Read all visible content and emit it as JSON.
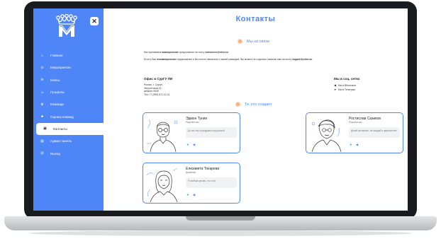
{
  "sidebar": {
    "close_label": "✕",
    "items": [
      {
        "label": "Главная",
        "icon": "home-icon",
        "glyph": "⌂",
        "active": false
      },
      {
        "label": "Мероприятия",
        "icon": "location-icon",
        "glyph": "⊙",
        "active": false
      },
      {
        "label": "Кейсы",
        "icon": "case-icon",
        "glyph": "⊖",
        "active": false
      },
      {
        "label": "Профиль",
        "icon": "profile-icon",
        "glyph": "☺",
        "active": false
      },
      {
        "label": "Команда",
        "icon": "team-icon",
        "glyph": "⊕",
        "active": false
      },
      {
        "label": "Оценка команд",
        "icon": "rating-icon",
        "glyph": "♣",
        "active": false
      },
      {
        "label": "Контакты",
        "icon": "contacts-icon",
        "glyph": "▣",
        "active": true
      },
      {
        "label": "Админ панель",
        "icon": "admin-icon",
        "glyph": "▤",
        "active": false
      },
      {
        "label": "Выход",
        "icon": "logout-icon",
        "glyph": "⊟",
        "active": false
      }
    ]
  },
  "main": {
    "title": "Контакты",
    "in_touch": {
      "title": "Мы на связи",
      "line1_pre": "Мы принимаем ",
      "line1_bold": "коммерческие",
      "line1_mid": " предложения на почту ",
      "line1_email": "commerce@edro.su",
      "line2_pre": "Если у Вас ",
      "line2_bold": "некоммерческое",
      "line2_mid": " предложение и Вы хотите связаться с нашей командой, Вы можете это сделать написав нам на почту ",
      "line2_email": "support@edro.su"
    },
    "office": {
      "title": "Офис в СурГУ ПИ",
      "lines": [
        "Россия, г. Сургут,",
        "Энергетиков 22,",
        "кабинет 900Е",
        "Тел: +7 (999) 571 10-31"
      ]
    },
    "social": {
      "title": "Мы в соц. сетях",
      "items": [
        {
          "label": "Мы в ВКонтакте",
          "icon": "vk-icon",
          "glyph": "◀"
        },
        {
          "label": "Мы в Телеграм",
          "icon": "telegram-icon",
          "glyph": "➤"
        }
      ]
    },
    "creators": {
      "title": "Те, кто создает",
      "cards": [
        {
          "name": "Эдмон Тунян",
          "role": "Разработчик",
          "quote": "До сих пор в раздумья над фразой"
        },
        {
          "name": "Ростислав Сазиков",
          "role": "Разработчик",
          "quote": "Делай желаемое, не ожидай в одиночестве"
        },
        {
          "name": "Елизавета Токарева",
          "role": "Дизайнер",
          "quote": "Я вообще делаю, что хочу"
        }
      ]
    }
  },
  "colors": {
    "accent": "#4f86f7",
    "dot": "#ffb07a",
    "sidebar": "#4f86f7"
  }
}
